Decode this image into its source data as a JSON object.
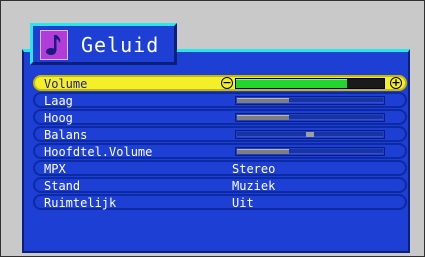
{
  "menu": {
    "title": "Geluid",
    "icon": "music-note-icon",
    "accent_color": "#1d3fd4",
    "highlight_color": "#f3f02a"
  },
  "rows": [
    {
      "label": "Volume",
      "type": "slider",
      "level": 0.75,
      "selected": true
    },
    {
      "label": "Laag",
      "type": "slider",
      "level": 0.35
    },
    {
      "label": "Hoog",
      "type": "slider",
      "level": 0.35
    },
    {
      "label": "Balans",
      "type": "balance",
      "level": 0.5
    },
    {
      "label": "Hoofdtel.Volume",
      "type": "slider",
      "level": 0.35
    },
    {
      "label": "MPX",
      "type": "text",
      "value": "Stereo"
    },
    {
      "label": "Stand",
      "type": "text",
      "value": "Muziek"
    },
    {
      "label": "Ruimtelijk",
      "type": "text",
      "value": "Uit"
    }
  ]
}
